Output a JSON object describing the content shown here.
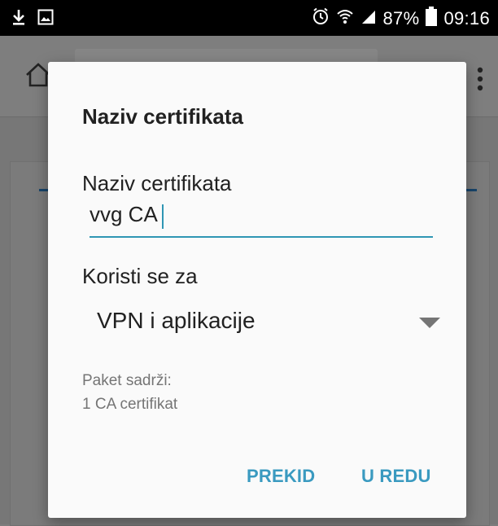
{
  "status_bar": {
    "battery": "87%",
    "time": "09:16",
    "icons": [
      "download-icon",
      "image-icon",
      "alarm-icon",
      "wifi-icon",
      "signal-icon",
      "battery-icon"
    ]
  },
  "background_app": {
    "icons": [
      "home-icon",
      "more-vert-icon"
    ]
  },
  "dialog": {
    "title": "Naziv certifikata",
    "name_field": {
      "label": "Naziv certifikata",
      "value": "vvg CA"
    },
    "usage": {
      "label": "Koristi se za",
      "selected": "VPN i aplikacije"
    },
    "package": {
      "label": "Paket sadrži:",
      "value": "1 CA certifikat"
    },
    "buttons": {
      "cancel": "PREKID",
      "ok": "U REDU"
    }
  },
  "colors": {
    "accent": "#2f96b4",
    "button_text": "#3a9ac0",
    "scrim": "#7d7d7d"
  }
}
